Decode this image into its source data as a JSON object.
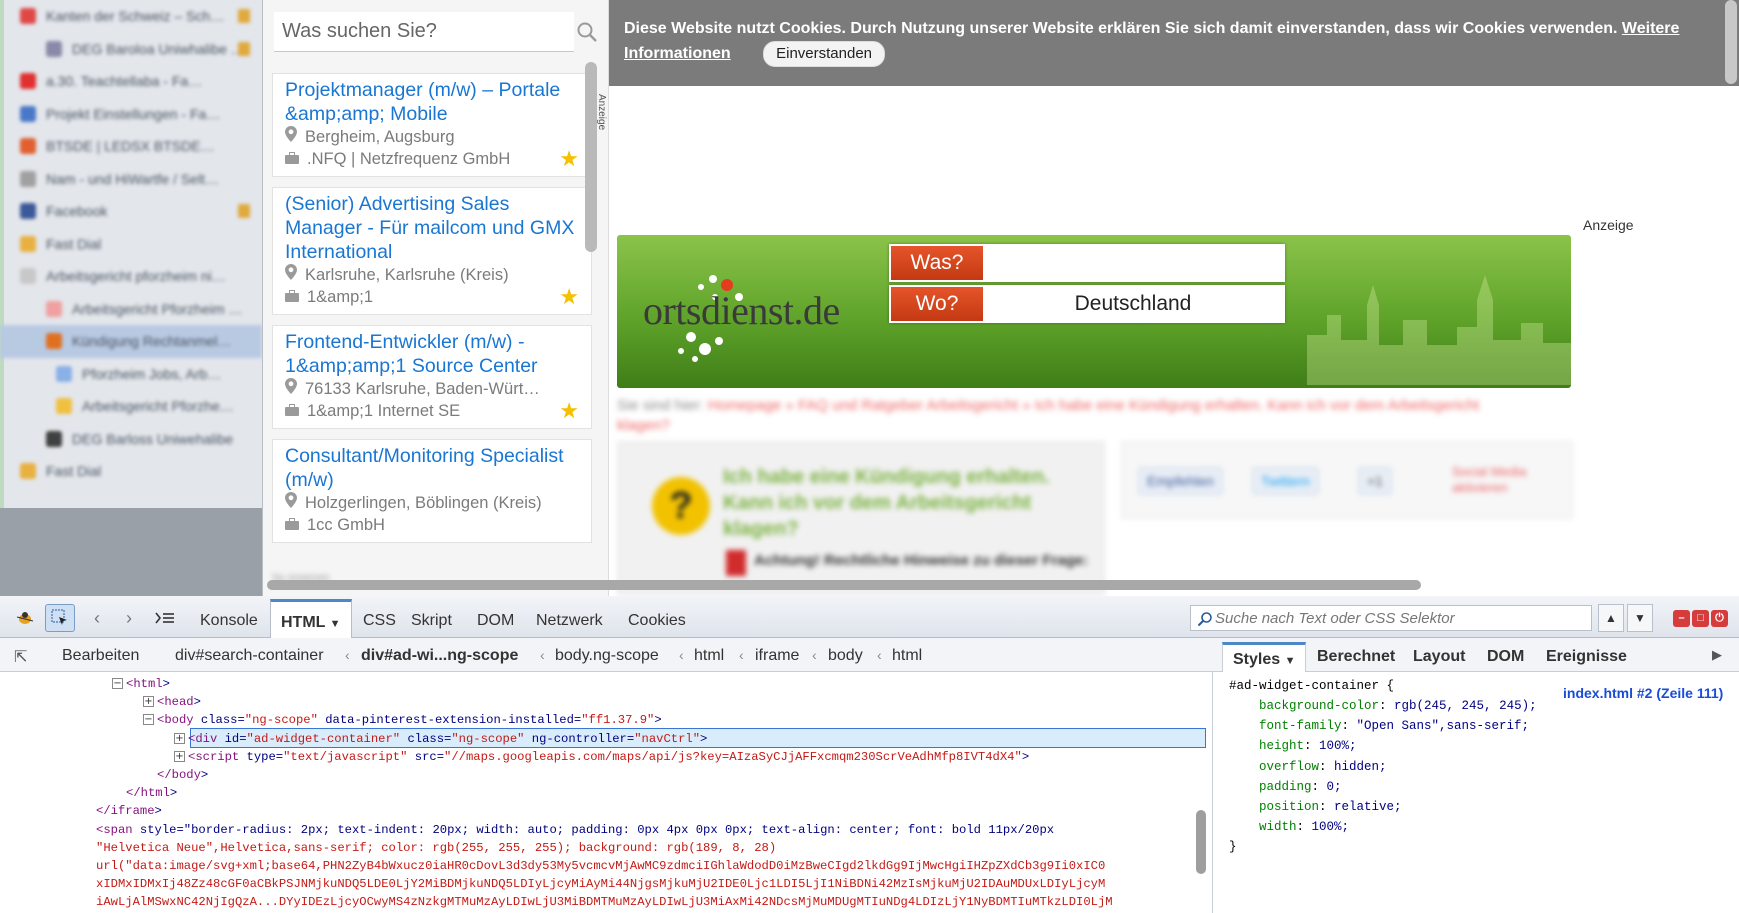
{
  "sidebar": {
    "tabs": [
      {
        "label": "Kanten der Schweiz – Sch…",
        "color": "#e04848",
        "indent": 0,
        "lock": true
      },
      {
        "label": "DEG Baroloa Uniwhalibe …",
        "color": "#8a8aa8",
        "indent": 1,
        "lock": true
      },
      {
        "label": "a.30. Teachtellaba - Fa…",
        "color": "#e03030",
        "indent": 0,
        "lock": false
      },
      {
        "label": "Projekt Einstellungen - Fa…",
        "color": "#4a78c8",
        "indent": 0,
        "lock": false
      },
      {
        "label": "BTSDE | LEDSX BTSDE…",
        "color": "#e06030",
        "indent": 0,
        "lock": false
      },
      {
        "label": "Nam - und HiWartfe / Selt…",
        "color": "#a0a0a0",
        "indent": 0,
        "lock": false
      },
      {
        "label": "Facebook",
        "color": "#3b5998",
        "indent": 0,
        "lock": true
      },
      {
        "label": "Fast Dial",
        "color": "#e8b040",
        "indent": 0,
        "lock": false
      },
      {
        "label": "Arbeitsgericht pforzheim ni…",
        "color": "#c8c8c8",
        "indent": 0,
        "lock": false
      },
      {
        "label": "Arbeitsgericht Pforzheim …",
        "color": "#f0a0a0",
        "indent": 1,
        "lock": false
      },
      {
        "label": "Kündigung Rechtanmel…",
        "color": "#e07020",
        "indent": 1,
        "lock": false,
        "selected": true
      },
      {
        "label": "Pforzheim Jobs, Arb…",
        "color": "#8ab0e8",
        "indent": 2,
        "lock": false
      },
      {
        "label": "Arbeitsgericht Pforzhe…",
        "color": "#f0c040",
        "indent": 2,
        "lock": false
      },
      {
        "label": "DEG Barloss Uniwehalibe",
        "color": "#404040",
        "indent": 1,
        "lock": false
      },
      {
        "label": "Fast Dial",
        "color": "#e8b040",
        "indent": 0,
        "lock": false
      }
    ]
  },
  "job_widget": {
    "search_placeholder": "Was suchen Sie?",
    "jobs": [
      {
        "title": "Projektmanager (m/w) – Portale &amp;amp; Mobile",
        "location": "Bergheim, Augsburg",
        "company": ".NFQ | Netzfrequenz GmbH",
        "starred": true
      },
      {
        "title": "(Senior) Advertising Sales Manager - Für mailcom und GMX International",
        "location": "Karlsruhe, Karlsruhe (Kreis)",
        "company": "1&amp;1",
        "starred": true
      },
      {
        "title": "Frontend-Entwickler (m/w) - 1&amp;amp;1 Source Center",
        "location": "76133 Karlsruhe, Baden-Würt…",
        "company": "1&amp;1 Internet SE",
        "starred": true
      },
      {
        "title": "Consultant/Monitoring Specialist (m/w)",
        "location": "Holzgerlingen, Böblingen (Kreis)",
        "company": "1cc GmbH",
        "starred": false
      }
    ],
    "footer": "by onsenes"
  },
  "cookie_banner": {
    "text": "Diese Website nutzt Cookies. Durch Nutzung unserer Website erklären Sie sich damit einverstanden, dass wir Cookies verwenden. ",
    "link": "Weitere Informationen",
    "accept": "Einverstanden"
  },
  "ad": {
    "label": "Anzeige",
    "vertical_label": "Anzeige",
    "logo": "ortsdienst.de",
    "was_label": "Was?",
    "was_value": "",
    "wo_label": "Wo?",
    "wo_value": "Deutschland"
  },
  "article": {
    "breadcrumb_prefix": "Sie sind hier: ",
    "breadcrumb": "Homepage » FAQ und Ratgeber Arbeitsgericht » Ich habe eine Kündigung erhalten. Kann ich vor dem Arbeitsgericht klagen?",
    "title": "Ich habe eine Kündigung erhalten. Kann ich vor dem Arbeitsgericht klagen?",
    "warning": "Achtung! Rechtliche Hinweise zu dieser Frage:",
    "share_facebook": "Empfehlen",
    "share_twitter": "Twittern",
    "share_gplus": "+1",
    "social_link": "Social Media aktivieren"
  },
  "devtools": {
    "tabs": [
      "Konsole",
      "HTML",
      "CSS",
      "Skript",
      "DOM",
      "Netzwerk",
      "Cookies"
    ],
    "active_tab": "HTML",
    "search_placeholder": "Suche nach Text oder CSS Selektor",
    "edit_label": "Bearbeiten",
    "breadcrumb": [
      "div#search-container",
      "div#ad-wi...ng-scope",
      "body.ng-scope",
      "html",
      "iframe",
      "body",
      "html"
    ],
    "side_tabs": [
      "Styles",
      "Berechnet",
      "Layout",
      "DOM",
      "Ereignisse"
    ],
    "html_lines": [
      {
        "indent": 0,
        "toggle": "−",
        "markup": "<html>"
      },
      {
        "indent": 1,
        "toggle": "+",
        "markup": "<head>"
      },
      {
        "indent": 1,
        "toggle": "−",
        "markup": "<body class=\"ng-scope\" data-pinterest-extension-installed=\"ff1.37.9\">"
      },
      {
        "indent": 2,
        "toggle": "+",
        "markup": "<div id=\"ad-widget-container\" class=\"ng-scope\" ng-controller=\"navCtrl\">",
        "selected": true
      },
      {
        "indent": 2,
        "toggle": "+",
        "markup": "<script type=\"text/javascript\" src=\"//maps.googleapis.com/maps/api/js?key=AIzaSyCJjAFFxcmqm230ScrVeAdhMfp8IVT4dX4\">"
      },
      {
        "indent": 1,
        "toggle": "",
        "markup": "</body>"
      },
      {
        "indent": 0,
        "toggle": "",
        "markup": "</html>"
      },
      {
        "indent": -1,
        "toggle": "",
        "markup": "</iframe>"
      },
      {
        "indent": -1,
        "toggle": "",
        "markup": "<span style=\"border-radius: 2px; text-indent: 20px; width: auto; padding: 0px 4px 0px 0px; text-align: center; font: bold 11px/20px"
      },
      {
        "indent": -1,
        "toggle": "",
        "markup": "\"Helvetica Neue\",Helvetica,sans-serif; color: rgb(255, 255, 255); background: rgb(189, 8, 28)"
      },
      {
        "indent": -1,
        "toggle": "",
        "markup": "url(\"data:image/svg+xml;base64,PHN2ZyB4bWxucz0iaHR0cDovL3d3dy53My5vcmcvMjAwMC9zdmciIGhlaWdodD0iMzBweCIgd2lkdGg9IjMwcHgiIHZpZXdCb3g9Ii0xIC0"
      },
      {
        "indent": -1,
        "toggle": "",
        "markup": "xIDMxIDMxIj48Zz48cGF0aCBkPSJNMjkuNDQ5LDE0LjY2MiBDMjkuNDQ5LDIyLjcyMiAyMi44NjgsMjkuMjU2IDE0Ljc1LDI5LjI1NiBDNi42MzIsMjkuMjU2IDAuMDUxLDIyLjcyM"
      },
      {
        "indent": -1,
        "toggle": "",
        "markup": "iAwLjAlMSwxNC42NjIgQzA...DYyIDEzLjcyOCwyMS4zNzkgMTMuMzAyLDIwLjU3MiBDMTMuMzAyLDIwLjU3MiAxMi42NDcsMjMuMDUgMTIuNDg4LDIzLjY1NyBDMTIuMTkzLDI0LjM"
      }
    ],
    "css": {
      "selector": "#ad-widget-container {",
      "source": "index.html #2 (Zeile 111)",
      "rules": [
        {
          "prop": "background-color",
          "value": "rgb(245, 245, 245);"
        },
        {
          "prop": "font-family",
          "value": "\"Open Sans\",sans-serif;"
        },
        {
          "prop": "height",
          "value": "100%;"
        },
        {
          "prop": "overflow",
          "value": "hidden;"
        },
        {
          "prop": "padding",
          "value": "0;"
        },
        {
          "prop": "position",
          "value": "relative;"
        },
        {
          "prop": "width",
          "value": "100%;"
        }
      ],
      "close": "}"
    }
  },
  "colors": {
    "link_blue": "#1976d2",
    "cookie_bg": "#7b7b7b",
    "star": "#f5c000",
    "ortsdienst_red": "#d8471c",
    "ortsdienst_green": "#5fa32a"
  }
}
